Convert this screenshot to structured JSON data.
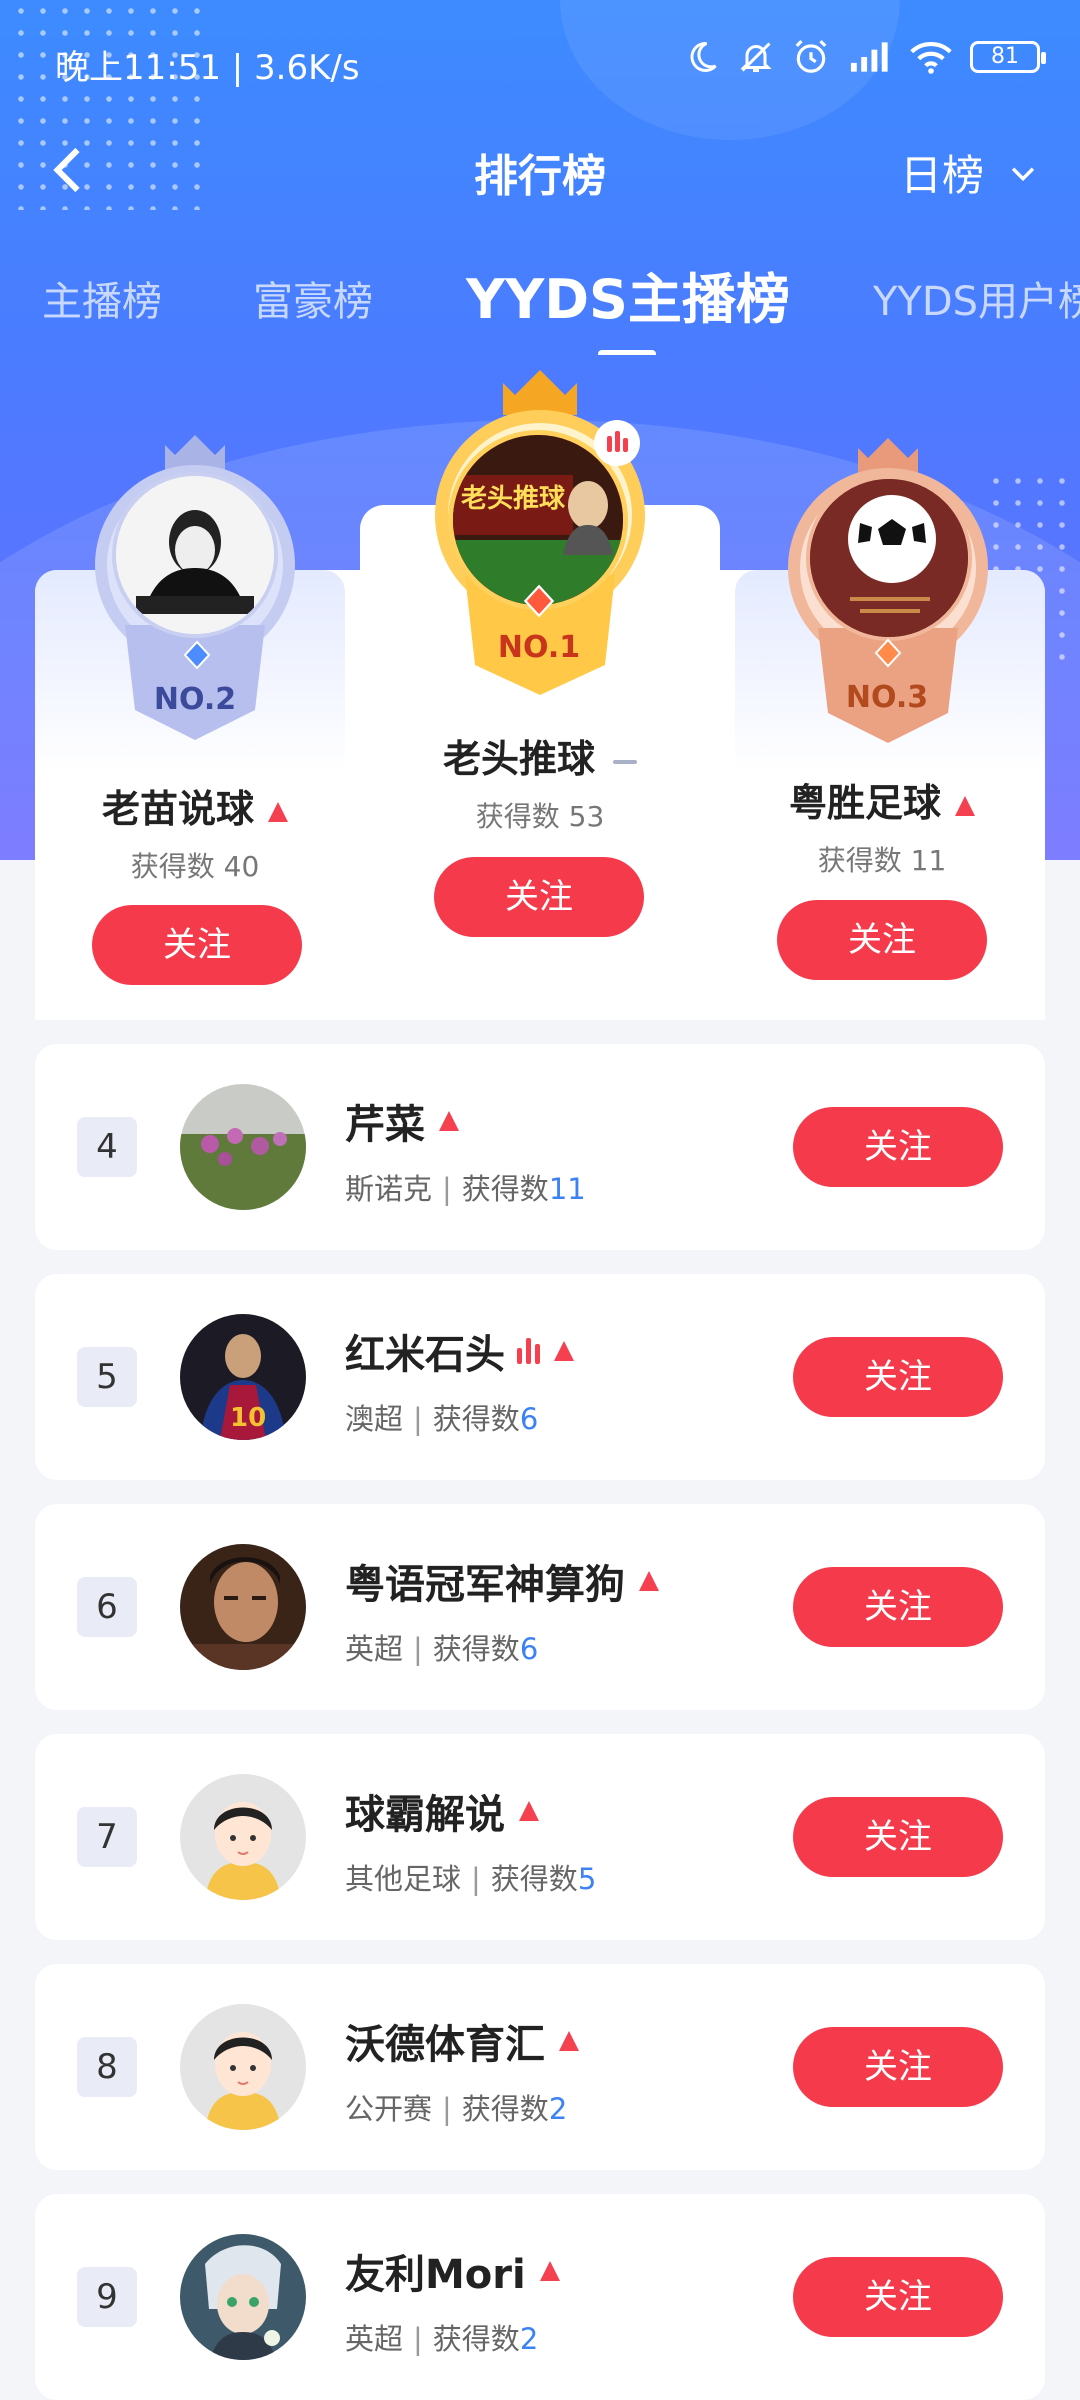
{
  "status": {
    "time": "晚上11:51 | 3.6K/s",
    "battery": "81"
  },
  "nav": {
    "title": "排行榜",
    "period": "日榜"
  },
  "tabs": [
    "主播榜",
    "富豪榜",
    "YYDS主播榜",
    "YYDS用户榜"
  ],
  "podium": [
    {
      "rank_label": "NO.2",
      "name": "老苗说球",
      "count": "获得数 40",
      "follow": "关注",
      "trend": "up"
    },
    {
      "rank_label": "NO.1",
      "name": "老头推球",
      "count": "获得数 53",
      "follow": "关注",
      "trend": "flat",
      "avatar_text": "老头推球"
    },
    {
      "rank_label": "NO.3",
      "name": "粤胜足球",
      "count": "获得数 11",
      "follow": "关注",
      "trend": "up"
    }
  ],
  "list": [
    {
      "rank": "4",
      "name": "芹菜",
      "league": "斯诺克",
      "count_label": "获得数",
      "count": "11",
      "follow": "关注"
    },
    {
      "rank": "5",
      "name": "红米石头",
      "league": "澳超",
      "count_label": "获得数",
      "count": "6",
      "follow": "关注"
    },
    {
      "rank": "6",
      "name": "粤语冠军神算狗",
      "league": "英超",
      "count_label": "获得数",
      "count": "6",
      "follow": "关注"
    },
    {
      "rank": "7",
      "name": "球霸解说",
      "league": "其他足球",
      "count_label": "获得数",
      "count": "5",
      "follow": "关注"
    },
    {
      "rank": "8",
      "name": "沃德体育汇",
      "league": "公开赛",
      "count_label": "获得数",
      "count": "2",
      "follow": "关注"
    },
    {
      "rank": "9",
      "name": "友利Mori",
      "league": "英超",
      "count_label": "获得数",
      "count": "2",
      "follow": "关注"
    }
  ],
  "colors": {
    "accent": "#f53b4b",
    "hero_blue": "#3d8bff",
    "count_blue": "#3b82f6"
  }
}
